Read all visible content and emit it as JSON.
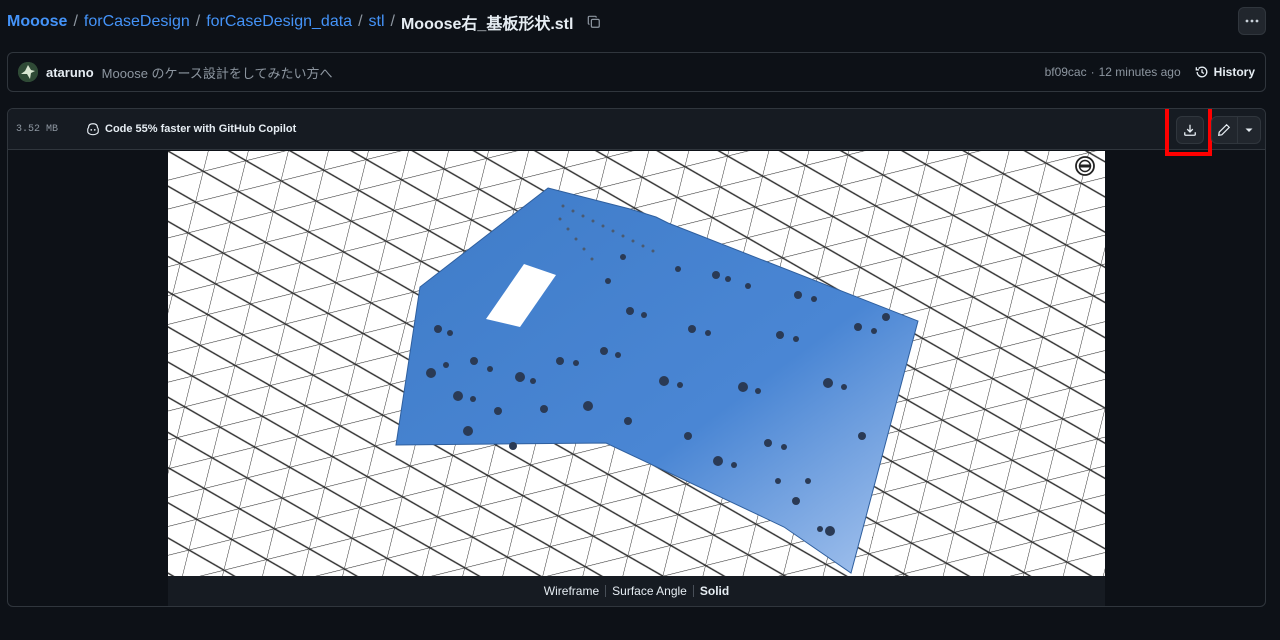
{
  "breadcrumb": {
    "repo": "Mooose",
    "folder1": "forCaseDesign",
    "folder2": "forCaseDesign_data",
    "folder3": "stl",
    "file": "Mooose右_基板形状.stl",
    "separator": "/"
  },
  "commit": {
    "author": "ataruno",
    "message": "Mooose のケース設計をしてみたい方へ",
    "sha": "bf09cac",
    "time": "12 minutes ago",
    "separator": "·",
    "history_label": "History"
  },
  "file": {
    "size": "3.52 MB",
    "copilot_promo": "Code 55% faster with GitHub Copilot"
  },
  "viewer": {
    "modes": [
      "Wireframe",
      "Surface Angle",
      "Solid"
    ],
    "active_mode": "Solid"
  },
  "colors": {
    "background": "#0d1117",
    "link": "#4493f8",
    "plate": "#4a86d4",
    "highlight": "#ff0000"
  },
  "icons": [
    "copy-icon",
    "kebab-icon",
    "history-icon",
    "copilot-icon",
    "download-icon",
    "pencil-icon",
    "triangle-down-icon",
    "reset-view-icon"
  ]
}
